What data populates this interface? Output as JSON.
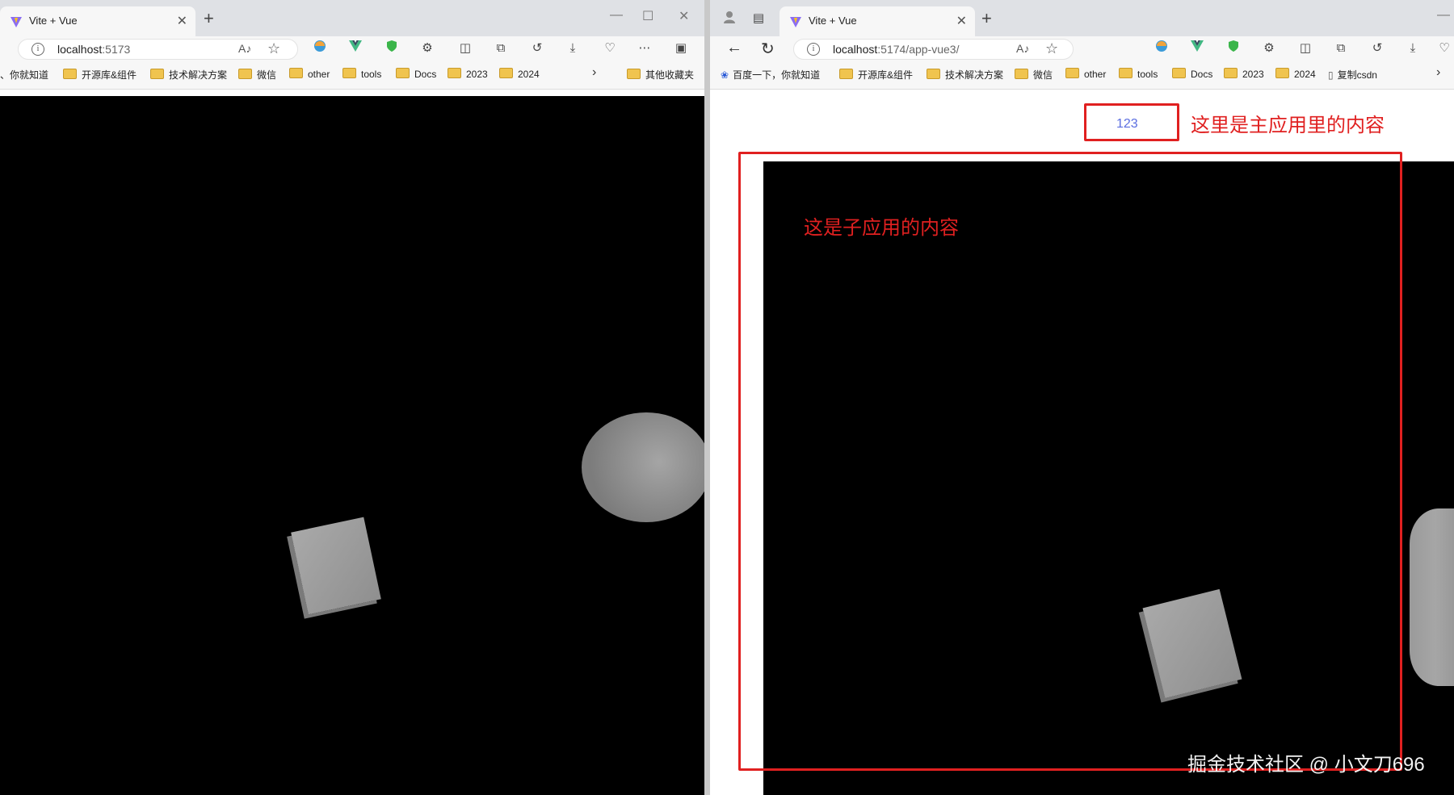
{
  "left_window": {
    "tab_title": "Vite + Vue",
    "address": {
      "host": "localhost",
      "port": ":5173"
    },
    "bookmarks": [
      "、你就知道",
      "开源库&组件",
      "技术解决方案",
      "微信",
      "other",
      "tools",
      "Docs",
      "2023",
      "2024",
      "其他收藏夹"
    ]
  },
  "right_window": {
    "tab_title": "Vite + Vue",
    "address": {
      "host": "localhost",
      "rest": ":5174/app-vue3/"
    },
    "bookmarks": [
      "百度一下，你就知道",
      "开源库&组件",
      "技术解决方案",
      "微信",
      "other",
      "tools",
      "Docs",
      "2023",
      "2024",
      "复制csdn"
    ],
    "main_app": {
      "counter_value": "123",
      "annotation": "这里是主应用里的内容"
    },
    "sub_app": {
      "annotation": "这是子应用的内容"
    }
  },
  "watermark": "掘金技术社区 @ 小文刀696",
  "colors": {
    "annotation_red": "#e02020",
    "counter_blue": "#5b6ee0",
    "canvas_bg": "#000000"
  },
  "icons": [
    "vite-favicon",
    "close-icon",
    "new-tab-icon",
    "minimize-icon",
    "maximize-icon",
    "back-icon",
    "reload-icon",
    "info-icon",
    "read-aloud-icon",
    "favorite-star-icon",
    "extension-icon",
    "split-screen-icon",
    "collections-icon",
    "history-icon",
    "downloads-icon",
    "more-icon",
    "folder-icon",
    "profile-icon",
    "tab-actions-icon"
  ]
}
